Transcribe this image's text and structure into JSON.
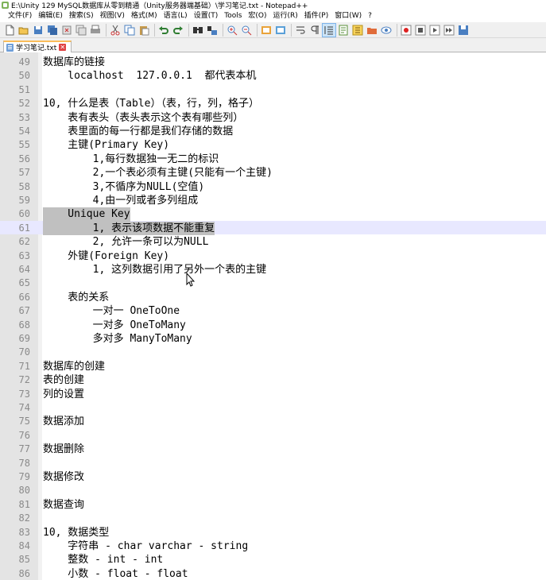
{
  "window": {
    "title": "E:\\Unity 129 MySQL数据库从零到精通（Unity服务器端基础）\\学习笔记.txt - Notepad++"
  },
  "menu": [
    "文件(F)",
    "编辑(E)",
    "搜索(S)",
    "视图(V)",
    "格式(M)",
    "语言(L)",
    "设置(T)",
    "Tools",
    "宏(O)",
    "运行(R)",
    "插件(P)",
    "窗口(W)",
    "?"
  ],
  "toolbar": {
    "icons": [
      "new-file-icon",
      "open-file-icon",
      "save-icon",
      "save-all-icon",
      "close-icon",
      "close-all-icon",
      "print-icon",
      "cut-icon",
      "copy-icon",
      "paste-icon",
      "undo-icon",
      "redo-icon",
      "find-icon",
      "replace-icon",
      "zoom-in-icon",
      "zoom-out-icon",
      "sync-vertical-icon",
      "sync-horizontal-icon",
      "word-wrap-icon",
      "show-all-chars-icon",
      "indent-guide-icon",
      "doc-map-icon",
      "function-list-icon",
      "folder-workspace-icon",
      "monitor-icon",
      "record-macro-icon",
      "stop-macro-icon",
      "play-macro-icon",
      "run-macro-multiple-icon",
      "save-macro-icon"
    ]
  },
  "tab": {
    "label": "学习笔记.txt",
    "close": "✕"
  },
  "editor": {
    "lines": [
      {
        "n": "49",
        "t": "数据库的链接"
      },
      {
        "n": "50",
        "t": "    localhost  127.0.0.1  都代表本机"
      },
      {
        "n": "51",
        "t": ""
      },
      {
        "n": "52",
        "t": "10, 什么是表（Table）（表，行，列，格子）"
      },
      {
        "n": "53",
        "t": "    表有表头（表头表示这个表有哪些列）"
      },
      {
        "n": "54",
        "t": "    表里面的每一行都是我们存储的数据"
      },
      {
        "n": "55",
        "t": "    主键(Primary Key)"
      },
      {
        "n": "56",
        "t": "        1,每行数据独一无二的标识"
      },
      {
        "n": "57",
        "t": "        2,一个表必须有主键(只能有一个主键)"
      },
      {
        "n": "58",
        "t": "        3,不循序为NULL(空值)"
      },
      {
        "n": "59",
        "t": "        4,由一列或者多列组成"
      },
      {
        "n": "60",
        "t": "    Unique Key"
      },
      {
        "n": "61",
        "t": "        1, 表示该项数据不能重复"
      },
      {
        "n": "62",
        "t": "        2, 允许一条可以为NULL"
      },
      {
        "n": "63",
        "t": "    外键(Foreign Key)"
      },
      {
        "n": "64",
        "t": "        1, 这列数据引用了另外一个表的主键"
      },
      {
        "n": "65",
        "t": ""
      },
      {
        "n": "66",
        "t": "    表的关系"
      },
      {
        "n": "67",
        "t": "        一对一 OneToOne"
      },
      {
        "n": "68",
        "t": "        一对多 OneToMany"
      },
      {
        "n": "69",
        "t": "        多对多 ManyToMany"
      },
      {
        "n": "70",
        "t": ""
      },
      {
        "n": "71",
        "t": "数据库的创建"
      },
      {
        "n": "72",
        "t": "表的创建"
      },
      {
        "n": "73",
        "t": "列的设置"
      },
      {
        "n": "74",
        "t": ""
      },
      {
        "n": "75",
        "t": "数据添加"
      },
      {
        "n": "76",
        "t": ""
      },
      {
        "n": "77",
        "t": "数据删除"
      },
      {
        "n": "78",
        "t": ""
      },
      {
        "n": "79",
        "t": "数据修改"
      },
      {
        "n": "80",
        "t": ""
      },
      {
        "n": "81",
        "t": "数据查询"
      },
      {
        "n": "82",
        "t": ""
      },
      {
        "n": "83",
        "t": "10, 数据类型"
      },
      {
        "n": "84",
        "t": "    字符串 - char varchar - string"
      },
      {
        "n": "85",
        "t": "    整数 - int - int"
      },
      {
        "n": "86",
        "t": "    小数 - float - float"
      }
    ],
    "selected_lines": [
      "60",
      "61"
    ]
  },
  "colors": {
    "gutter": "#e4e4e4",
    "line_number": "#8a8a8a",
    "selection": "#c0c0c0",
    "caret_line": "#e8e8ff",
    "tab_accent": "#fabd5a"
  }
}
